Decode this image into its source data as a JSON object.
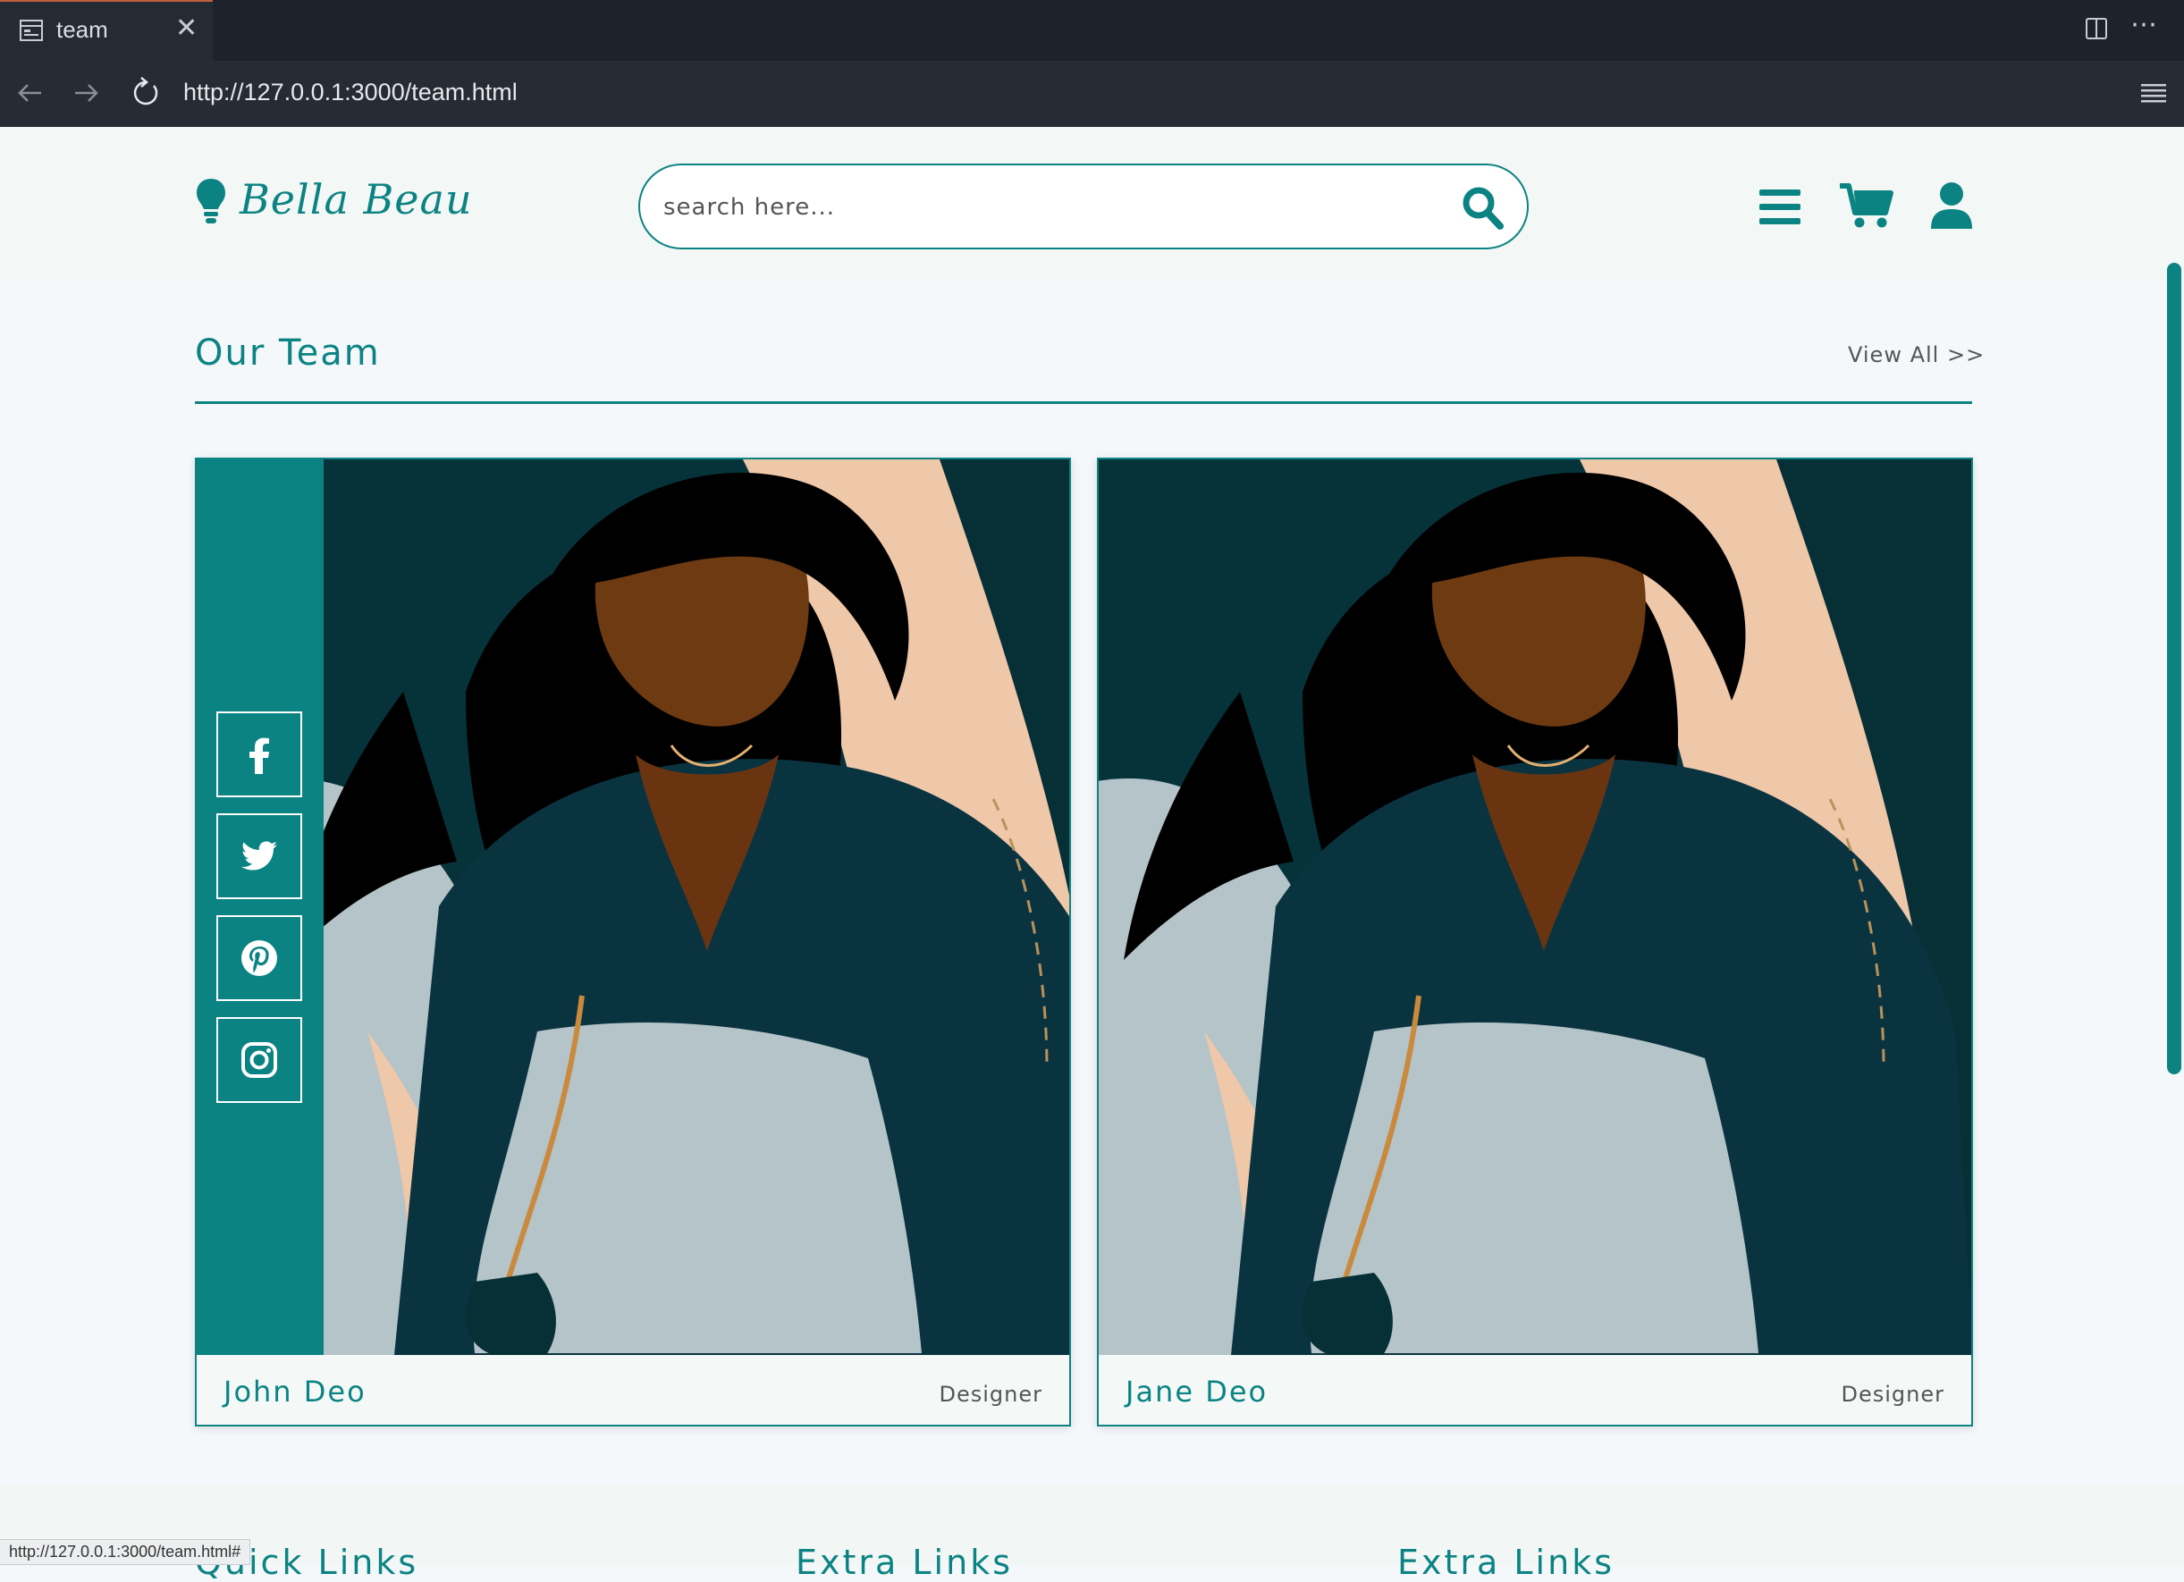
{
  "browser": {
    "tab_title": "team",
    "url": "http://127.0.0.1:3000/team.html",
    "status_url": "http://127.0.0.1:3000/team.html#"
  },
  "header": {
    "logo_text": "Bella Beau",
    "search_placeholder": "search here...",
    "icons": [
      "lightbulb-icon",
      "search-icon",
      "menu-icon",
      "cart-icon",
      "user-icon"
    ]
  },
  "team": {
    "title": "Our Team",
    "view_all": "View All >>",
    "members": [
      {
        "name": "John Deo",
        "role": "Designer"
      },
      {
        "name": "Jane Deo",
        "role": "Designer"
      }
    ],
    "social_icons": [
      "facebook-icon",
      "twitter-icon",
      "pinterest-icon",
      "instagram-icon"
    ]
  },
  "footer": {
    "headings": [
      "Quick Links",
      "Extra Links",
      "Extra Links"
    ]
  },
  "colors": {
    "accent": "#0c8383",
    "chrome_dark": "#1e222a",
    "page_bg": "#f5f8fb"
  }
}
